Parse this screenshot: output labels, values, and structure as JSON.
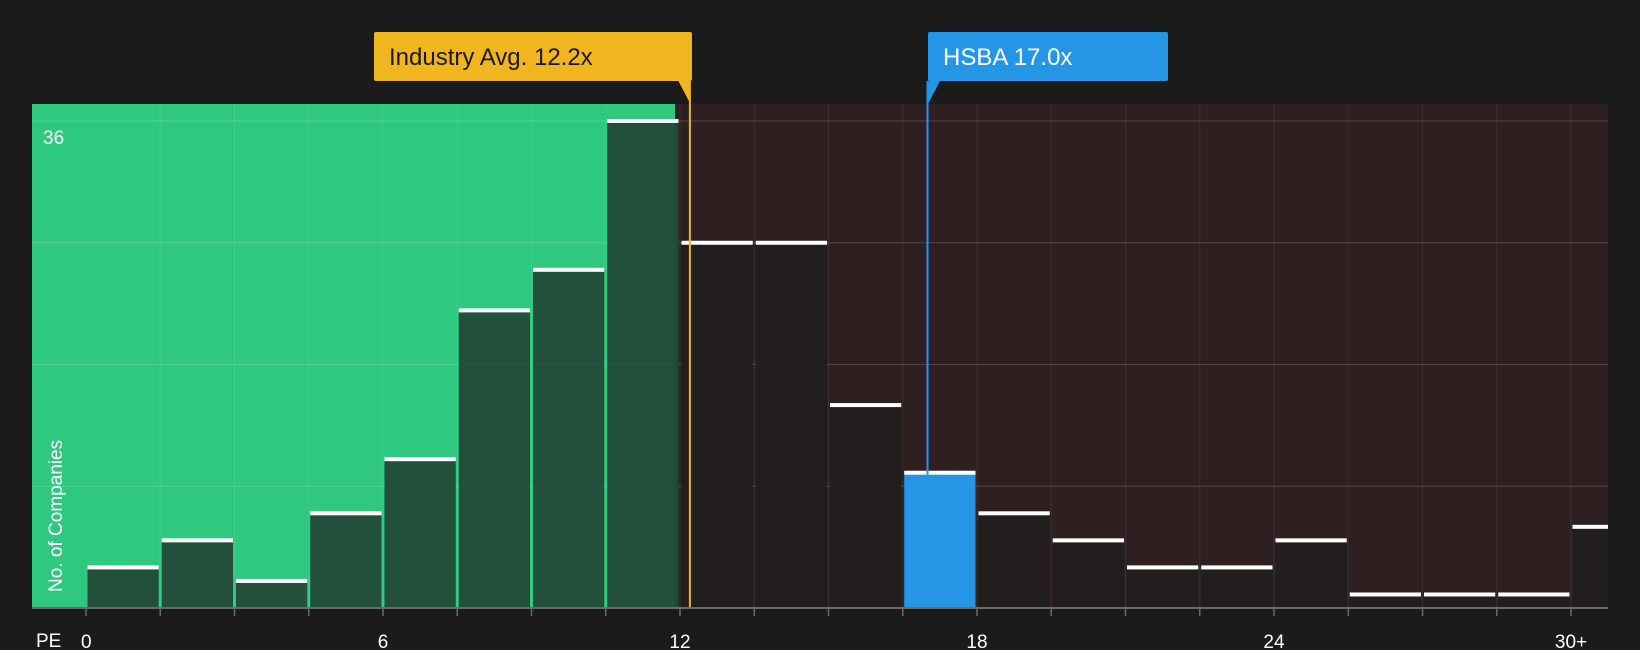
{
  "chart_data": {
    "type": "bar",
    "x_axis_label": "PE",
    "y_axis_label": "No. of Companies",
    "y_max_label": "36",
    "y_max": 36,
    "ylim": [
      0,
      36
    ],
    "xlim": [
      0,
      30
    ],
    "x_ticks": [
      {
        "value": 0,
        "label": "0"
      },
      {
        "value": 6,
        "label": "6"
      },
      {
        "value": 12,
        "label": "12"
      },
      {
        "value": 18,
        "label": "18"
      },
      {
        "value": 24,
        "label": "24"
      },
      {
        "value": 30,
        "label": "30+"
      }
    ],
    "bins": [
      {
        "start": 0.0,
        "end": 1.5,
        "value": 3
      },
      {
        "start": 1.5,
        "end": 3.0,
        "value": 5
      },
      {
        "start": 3.0,
        "end": 4.5,
        "value": 2
      },
      {
        "start": 4.5,
        "end": 6.0,
        "value": 7
      },
      {
        "start": 6.0,
        "end": 7.5,
        "value": 11
      },
      {
        "start": 7.5,
        "end": 9.0,
        "value": 22
      },
      {
        "start": 9.0,
        "end": 10.5,
        "value": 25
      },
      {
        "start": 10.5,
        "end": 12.0,
        "value": 36
      },
      {
        "start": 12.0,
        "end": 13.5,
        "value": 27
      },
      {
        "start": 13.5,
        "end": 15.0,
        "value": 27
      },
      {
        "start": 15.0,
        "end": 16.5,
        "value": 15
      },
      {
        "start": 16.5,
        "end": 18.0,
        "value": 10
      },
      {
        "start": 18.0,
        "end": 19.5,
        "value": 7
      },
      {
        "start": 19.5,
        "end": 21.0,
        "value": 5
      },
      {
        "start": 21.0,
        "end": 22.5,
        "value": 3
      },
      {
        "start": 22.5,
        "end": 24.0,
        "value": 3
      },
      {
        "start": 24.0,
        "end": 25.5,
        "value": 5
      },
      {
        "start": 25.5,
        "end": 27.0,
        "value": 1
      },
      {
        "start": 27.0,
        "end": 28.5,
        "value": 1
      },
      {
        "start": 28.5,
        "end": 30.0,
        "value": 1
      },
      {
        "start": 30.0,
        "end": 31.5,
        "value": 6
      }
    ],
    "highlight_bin_index": 11,
    "industry_avg": {
      "label": "Industry Avg. 12.2x",
      "value": 12.2,
      "color": "#f0b51f"
    },
    "company": {
      "label": "HSBA 17.0x",
      "value": 17.0,
      "color": "#2596e6"
    },
    "fair_region_end": 11.9,
    "colors": {
      "background": "#1b1b1b",
      "fair_region": "#2ec97f",
      "expensive_region": "#2e1f20",
      "bar_in_fair": "#234a38",
      "bar_in_expensive": "#221e1e",
      "bar_top_line": "#ffffff",
      "grid": "#4a4a4a"
    }
  }
}
